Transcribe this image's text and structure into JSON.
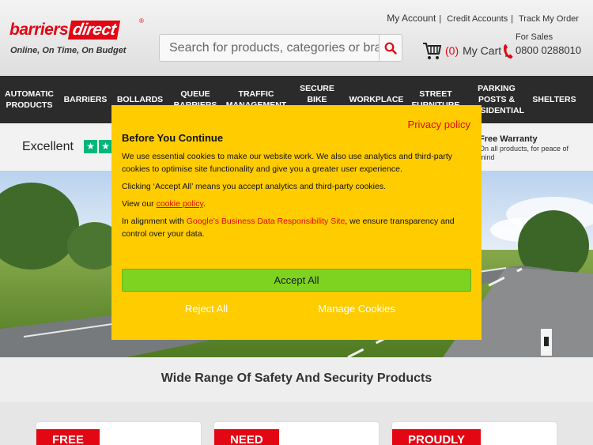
{
  "header": {
    "logo_word": "barriers",
    "logo_direct": "direct",
    "logo_reg": "®",
    "tagline": "Online, On Time, On Budget",
    "links": {
      "my_account": "My Account",
      "credit_accounts": "Credit Accounts",
      "track_order": "Track My Order",
      "sep": "|"
    },
    "search": {
      "placeholder": "Search for products, categories or bran",
      "icon": "search-icon"
    },
    "cart": {
      "count": "(0)",
      "label": "My Cart",
      "sep": "|"
    },
    "sales": {
      "label": "For Sales",
      "phone": "0800 0288010"
    }
  },
  "nav": {
    "items": [
      {
        "label": "AUTOMATIC\nPRODUCTS"
      },
      {
        "label": "BARRIERS"
      },
      {
        "label": "BOLLARDS"
      },
      {
        "label": "QUEUE\nBARRIERS"
      },
      {
        "label": "TRAFFIC\nMANAGEMENT"
      },
      {
        "label": "SECURE\nBIKE\nSTORAGE"
      },
      {
        "label": "WORKPLACE"
      },
      {
        "label": "STREET\nFURNITURE"
      },
      {
        "label": "PARKING\nPOSTS &\nRESIDENTIAL"
      },
      {
        "label": "SHELTERS"
      }
    ]
  },
  "trust": {
    "rating_word": "Excellent",
    "warranty_title": "Free Warranty",
    "warranty_text": "On all products, for peace of mind"
  },
  "section": {
    "title": "Wide Range Of Safety And Security Products"
  },
  "cards": [
    {
      "tag": "FREE"
    },
    {
      "tag": "NEED"
    },
    {
      "tag": "PROUDLY"
    }
  ],
  "cookie": {
    "privacy_link": "Privacy policy",
    "title": "Before You Continue",
    "p1": "We use essential cookies to make our website work. We also use analytics and third-party cookies to optimise site functionality and give you a greater user experience.",
    "p2": "Clicking ‘Accept All’ means you accept analytics and third-party cookies.",
    "p3_prefix": "View our ",
    "p3_link": "cookie policy",
    "p3_suffix": ".",
    "p4_prefix": "In alignment with ",
    "p4_link": "Google’s Business Data Responsibility Site",
    "p4_suffix": ", we ensure transparency and control over your data.",
    "accept": "Accept All",
    "reject": "Reject All",
    "manage": "Manage Cookies"
  },
  "colors": {
    "brand_red": "#e30613",
    "dialog_yellow": "#ffcc00",
    "accept_green": "#7ed321",
    "nav_dark": "#2b2b2b",
    "trustpilot_green": "#00b67a"
  }
}
